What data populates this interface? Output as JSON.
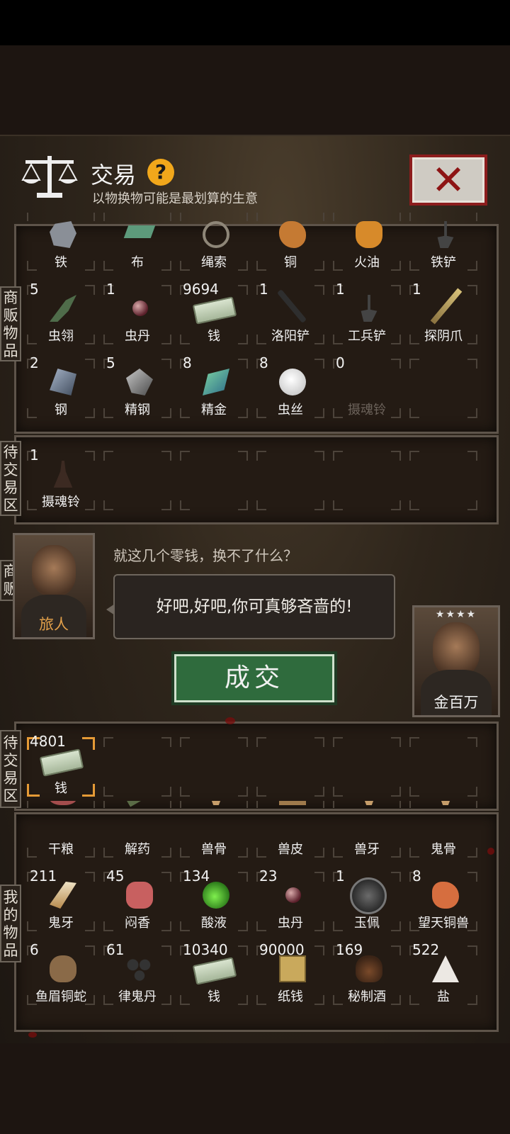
{
  "header": {
    "title": "交易",
    "help": "?",
    "subtitle": "以物换物可能是最划算的生意"
  },
  "tabs": {
    "merchant_goods": [
      "商",
      "贩",
      "物",
      "品"
    ],
    "pending_top": [
      "待",
      "交",
      "易",
      "区"
    ],
    "merchant": [
      "商",
      "贩"
    ],
    "pending_bottom": [
      "待",
      "交",
      "易",
      "区"
    ],
    "my_goods": [
      "我",
      "的",
      "物",
      "品"
    ]
  },
  "merchant_goods": [
    {
      "count": "",
      "name": "铁",
      "icon": "ore-icon"
    },
    {
      "count": "",
      "name": "布",
      "icon": "cloth-icon"
    },
    {
      "count": "",
      "name": "绳索",
      "icon": "rope-icon"
    },
    {
      "count": "",
      "name": "铜",
      "icon": "copper-icon"
    },
    {
      "count": "",
      "name": "火油",
      "icon": "oil-icon"
    },
    {
      "count": "",
      "name": "铁铲",
      "icon": "shovel-icon"
    },
    {
      "count": "5",
      "name": "虫翎",
      "icon": "wing-icon"
    },
    {
      "count": "1",
      "name": "虫丹",
      "icon": "pill-icon"
    },
    {
      "count": "9694",
      "name": "钱",
      "icon": "money-icon"
    },
    {
      "count": "1",
      "name": "洛阳铲",
      "icon": "rod-icon"
    },
    {
      "count": "1",
      "name": "工兵铲",
      "icon": "shovel-icon"
    },
    {
      "count": "1",
      "name": "探阴爪",
      "icon": "claw-icon"
    },
    {
      "count": "2",
      "name": "钢",
      "icon": "steel-icon"
    },
    {
      "count": "5",
      "name": "精钢",
      "icon": "refined-steel-icon"
    },
    {
      "count": "8",
      "name": "精金",
      "icon": "gold-icon"
    },
    {
      "count": "8",
      "name": "虫丝",
      "icon": "silk-icon"
    },
    {
      "count": "0",
      "name": "摄魂铃",
      "icon": "",
      "dim": true
    },
    {
      "count": "",
      "name": "",
      "icon": ""
    }
  ],
  "pending_merchant": [
    {
      "count": "1",
      "name": "摄魂铃",
      "icon": "bell-icon"
    }
  ],
  "merchant": {
    "portrait_label": "旅人",
    "says": "就这几个零钱，换不了什么？",
    "reply": "好吧,好吧,你可真够吝啬的!"
  },
  "player": {
    "stars": "★★★★",
    "name": "金百万"
  },
  "deal_button": "成交",
  "pending_mine": [
    {
      "count": "4801",
      "name": "钱",
      "icon": "money-icon",
      "selected": true
    }
  ],
  "my_goods": [
    {
      "count": "",
      "name": "干粮",
      "icon": "meat-icon"
    },
    {
      "count": "",
      "name": "解药",
      "icon": "antidote-icon"
    },
    {
      "count": "",
      "name": "兽骨",
      "icon": "bone-icon"
    },
    {
      "count": "",
      "name": "兽皮",
      "icon": "hide-icon"
    },
    {
      "count": "",
      "name": "兽牙",
      "icon": "bone-icon"
    },
    {
      "count": "",
      "name": "鬼骨",
      "icon": "bone-icon"
    },
    {
      "count": "211",
      "name": "鬼牙",
      "icon": "fang-icon"
    },
    {
      "count": "45",
      "name": "闷香",
      "icon": "incense-icon"
    },
    {
      "count": "134",
      "name": "酸液",
      "icon": "acid-icon"
    },
    {
      "count": "23",
      "name": "虫丹",
      "icon": "pill-icon"
    },
    {
      "count": "1",
      "name": "玉佩",
      "icon": "jade-icon"
    },
    {
      "count": "8",
      "name": "望天铜兽",
      "icon": "beast-icon"
    },
    {
      "count": "6",
      "name": "鱼眉铜蛇",
      "icon": "snake-icon"
    },
    {
      "count": "61",
      "name": "律鬼丹",
      "icon": "dan-icon"
    },
    {
      "count": "10340",
      "name": "钱",
      "icon": "money-icon"
    },
    {
      "count": "90000",
      "name": "纸钱",
      "icon": "paper-icon"
    },
    {
      "count": "169",
      "name": "秘制酒",
      "icon": "wine-icon"
    },
    {
      "count": "522",
      "name": "盐",
      "icon": "salt-icon"
    }
  ],
  "colors": {
    "accent": "#f1a71b",
    "deal_green": "#2f6b3d",
    "close_red": "#8d1414",
    "selected_corner": "#e59a36"
  }
}
